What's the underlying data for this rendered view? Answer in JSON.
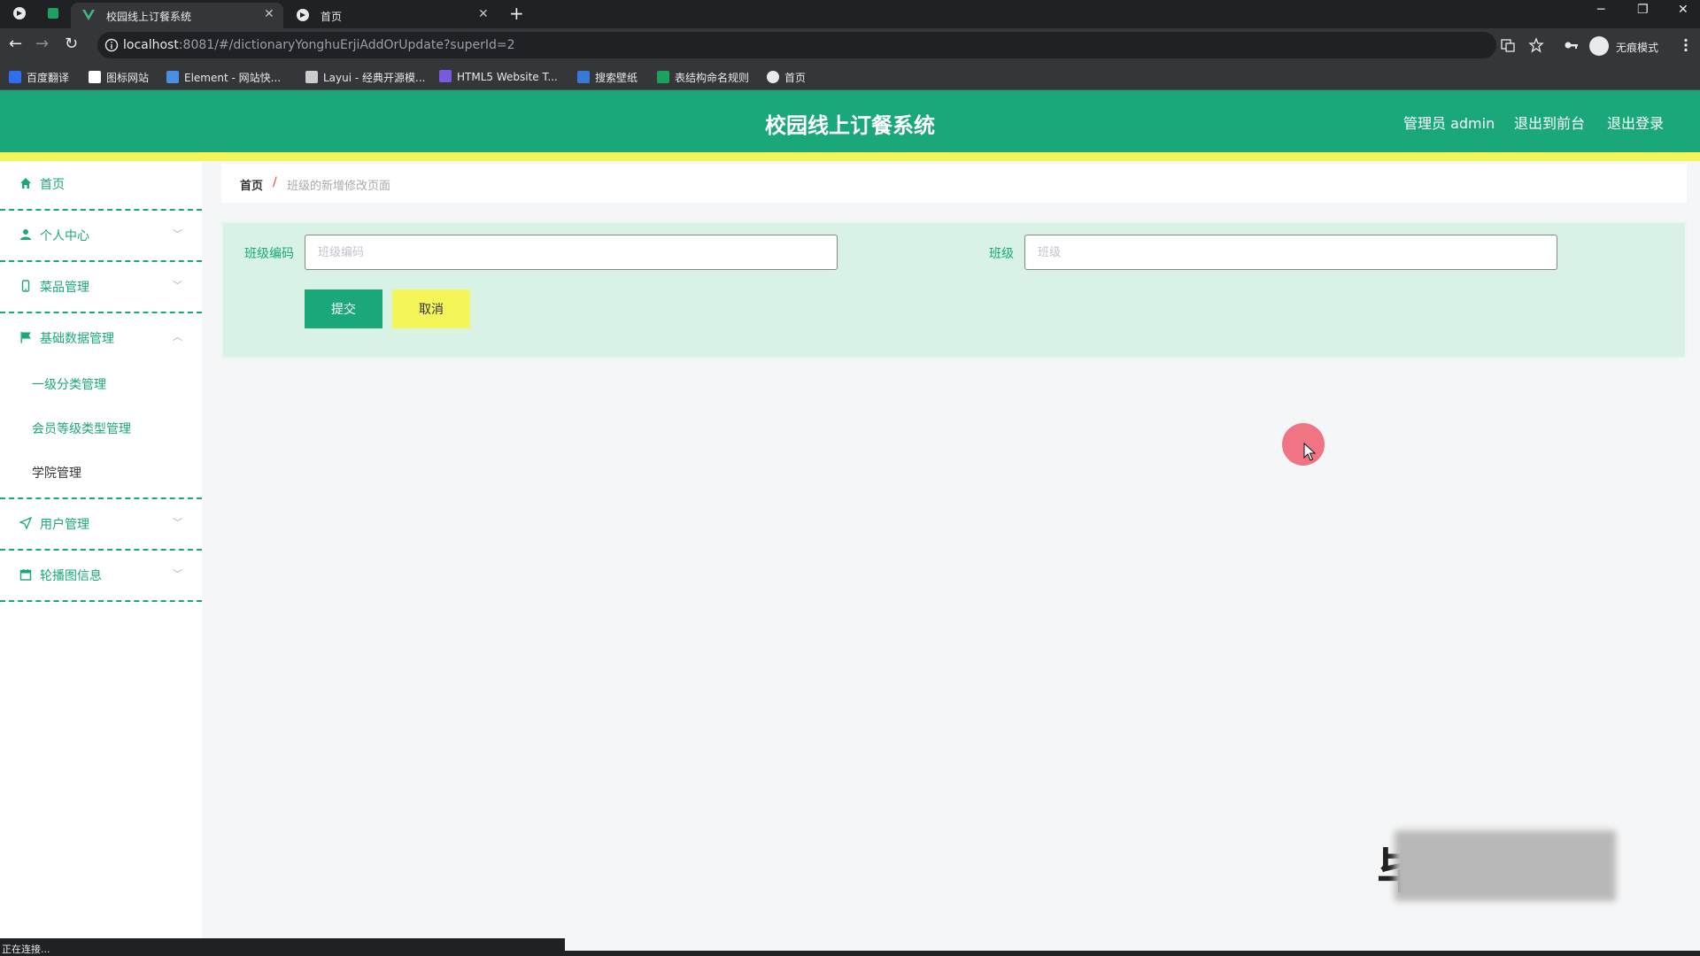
{
  "browser": {
    "tabs": [
      {
        "title": "校园线上订餐系统",
        "active": true
      },
      {
        "title": "首页",
        "active": false
      }
    ],
    "close_glyph": "✕",
    "new_tab_glyph": "+",
    "window_controls": {
      "minimize": "─",
      "restore": "❐",
      "close": "✕"
    },
    "url": {
      "host": "localhost",
      "path": ":8081/#/dictionaryYonghuErjiAddOrUpdate?superId=2"
    },
    "profile_label": "无痕模式",
    "bookmarks": [
      {
        "label": "百度翻译",
        "color": "#2e6ff0"
      },
      {
        "label": "图标网站",
        "color": "#ffffff"
      },
      {
        "label": "Element - 网站快...",
        "color": "#4a90e2"
      },
      {
        "label": "Layui - 经典开源模...",
        "color": "#cccccc"
      },
      {
        "label": "HTML5 Website T...",
        "color": "#7a5ae0"
      },
      {
        "label": "搜索壁纸",
        "color": "#3a78d8"
      },
      {
        "label": "表结构命名规则",
        "color": "#1aa35c"
      },
      {
        "label": "首页",
        "color": "#e8eaed"
      }
    ],
    "status_text": "正在连接..."
  },
  "header": {
    "title": "校园线上订餐系统",
    "admin_label": "管理员 admin",
    "front_link": "退出到前台",
    "logout_link": "退出登录"
  },
  "sidebar": {
    "items": [
      {
        "label": "首页",
        "icon": "home-icon",
        "has_chevron": false
      },
      {
        "label": "个人中心",
        "icon": "user-icon",
        "has_chevron": true
      },
      {
        "label": "菜品管理",
        "icon": "phone-icon",
        "has_chevron": true
      },
      {
        "label": "基础数据管理",
        "icon": "flag-icon",
        "has_chevron": true,
        "expanded": true
      },
      {
        "label": "用户管理",
        "icon": "send-icon",
        "has_chevron": true
      },
      {
        "label": "轮播图信息",
        "icon": "calendar-icon",
        "has_chevron": true
      }
    ],
    "subitems": [
      {
        "label": "一级分类管理",
        "active": false
      },
      {
        "label": "会员等级类型管理",
        "active": false
      },
      {
        "label": "学院管理",
        "active": true
      }
    ]
  },
  "breadcrumb": {
    "home": "首页",
    "separator": "/",
    "current": "班级的新增修改页面"
  },
  "form": {
    "field1": {
      "label": "班级编码",
      "placeholder": "班级编码",
      "value": ""
    },
    "field2": {
      "label": "班级",
      "placeholder": "班级",
      "value": ""
    },
    "submit_label": "提交",
    "cancel_label": "取消"
  },
  "watermark_text": "毕",
  "colors": {
    "primary": "#1aa779",
    "accent_yellow": "#f4f558",
    "panel_bg": "#d8f3e6",
    "breadcrumb_separator": "#e64545"
  }
}
